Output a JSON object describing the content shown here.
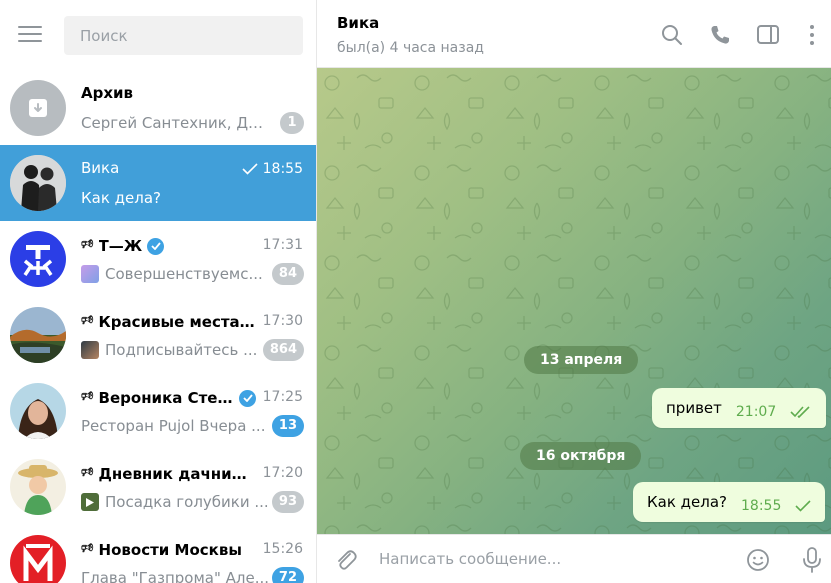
{
  "search": {
    "placeholder": "Поиск"
  },
  "chats": [
    {
      "title": "Архив",
      "time": "",
      "preview": "Сергей Сантехник, Дар...",
      "badge": "1",
      "badge_style": "gray"
    },
    {
      "title": "Вика",
      "time": "18:55",
      "preview": "Как дела?",
      "badge": "",
      "active": true,
      "read_check": true
    },
    {
      "title": "Т—Ж",
      "time": "17:31",
      "preview": "Совершенствуемс...",
      "badge": "84",
      "badge_style": "gray",
      "channel": true,
      "verified": true,
      "thumb_color": "#b08be0"
    },
    {
      "title": "Красивые места ...",
      "time": "17:30",
      "preview": "Подписывайтесь ...",
      "badge": "864",
      "badge_style": "gray",
      "channel": true,
      "thumb_color": "#6b4a3a"
    },
    {
      "title": "Вероника Сте...",
      "time": "17:25",
      "preview": "Ресторан Pujol  Вчера ...",
      "badge": "13",
      "badge_style": "blue",
      "channel": true,
      "verified": true
    },
    {
      "title": "Дневник дачник...",
      "time": "17:20",
      "preview": "Посадка голубики ...",
      "badge": "93",
      "badge_style": "gray",
      "channel": true,
      "thumb_color": "#4f6d3a"
    },
    {
      "title": "Новости Москвы",
      "time": "15:26",
      "preview": "Глава \"Газпрома\" Але...",
      "badge": "72",
      "badge_style": "blue",
      "channel": true
    }
  ],
  "header": {
    "name": "Вика",
    "status": "был(а) 4 часа назад"
  },
  "messages": [
    {
      "date": "13 апреля",
      "text": "привет",
      "time": "21:07",
      "status": "read"
    },
    {
      "date": "16 октября",
      "text": "Как дела?",
      "time": "18:55",
      "status": "sent"
    }
  ],
  "composer": {
    "placeholder": "Написать сообщение..."
  },
  "colors": {
    "accent": "#419fd9",
    "bubble_out": "#effdde",
    "badge_gray": "#c4c9cc",
    "badge_blue": "#3ea2e3",
    "time_green": "#5fac4e"
  },
  "icons": [
    "menu-icon",
    "archive-icon",
    "megaphone-icon",
    "verified-icon",
    "search-icon",
    "phone-icon",
    "sidebar-toggle-icon",
    "more-vertical-icon",
    "double-check-icon",
    "check-icon",
    "paperclip-icon",
    "emoji-icon",
    "microphone-icon"
  ]
}
